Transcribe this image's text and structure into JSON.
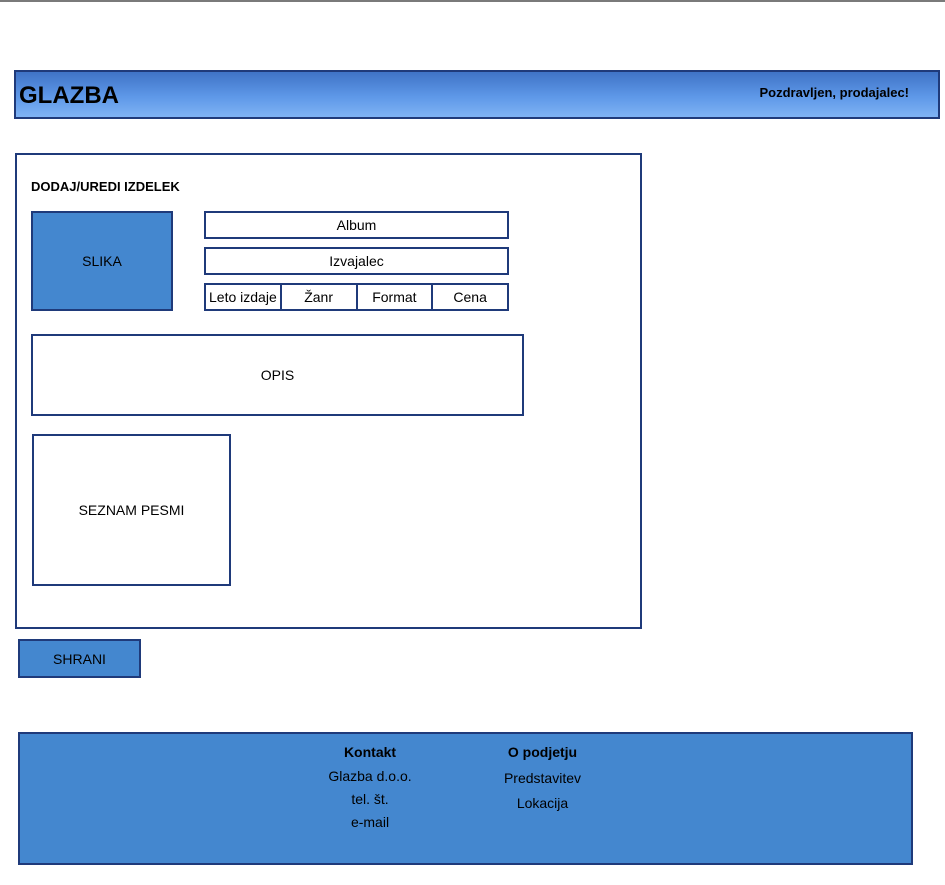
{
  "header": {
    "brand": "GLAZBA",
    "greeting": "Pozdravljen, prodajalec!"
  },
  "form": {
    "title": "DODAJ/UREDI IZDELEK",
    "image_label": "SLIKA",
    "album_label": "Album",
    "artist_label": "Izvajalec",
    "meta": [
      "Leto izdaje",
      "Žanr",
      "Format",
      "Cena"
    ],
    "description_label": "OPIS",
    "songs_label": "SEZNAM PESMI"
  },
  "save_label": "SHRANI",
  "footer": {
    "contact": {
      "heading": "Kontakt",
      "items": [
        "Glazba d.o.o.",
        "tel. št.",
        "e-mail"
      ]
    },
    "about": {
      "heading": "O podjetju",
      "items": [
        "Predstavitev",
        "Lokacija"
      ]
    }
  },
  "colors": {
    "border": "#1f3a7a",
    "fill": "#4487cf",
    "header_gradient_top": "#3f73c6",
    "header_gradient_bottom": "#7fb3f4"
  }
}
